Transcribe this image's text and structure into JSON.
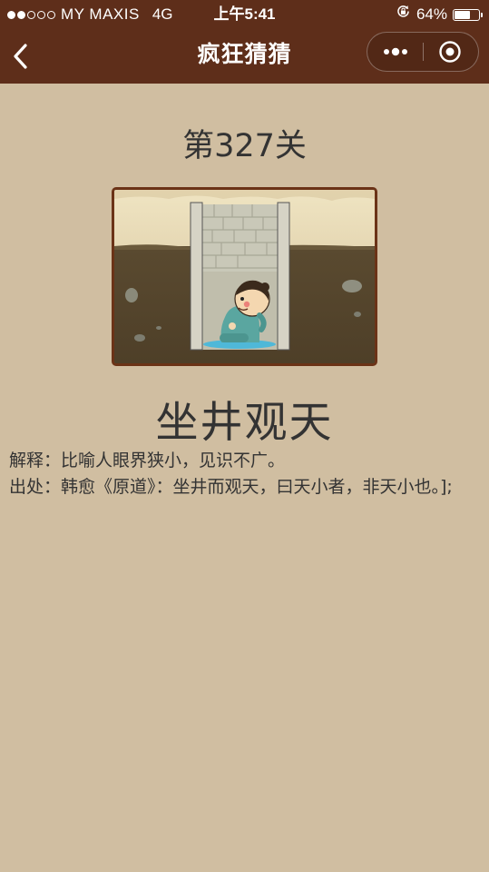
{
  "status_bar": {
    "signal_filled": 2,
    "signal_total": 5,
    "carrier": "MY MAXIS",
    "network": "4G",
    "time": "上午5:41",
    "battery_percent": "64%",
    "battery_level": 0.64,
    "rotation_lock_icon": "rotation-lock-icon"
  },
  "nav": {
    "title": "疯狂猜猜",
    "back_icon": "chevron-left-icon",
    "more_icon": "more-dots-icon",
    "close_icon": "target-close-icon"
  },
  "level": {
    "title": "第327关"
  },
  "puzzle": {
    "answer": "坐井观天",
    "explanation_label": "解释：",
    "explanation_text": "比喻人眼界狭小，见识不广。",
    "source_label": "出处：",
    "source_text": "韩愈《原道》：坐井而观天，曰天小者，非天小也。];"
  },
  "colors": {
    "background": "#d0bea1",
    "header": "#5e2e1a",
    "frame_border": "#6b3317",
    "text": "#333333"
  }
}
